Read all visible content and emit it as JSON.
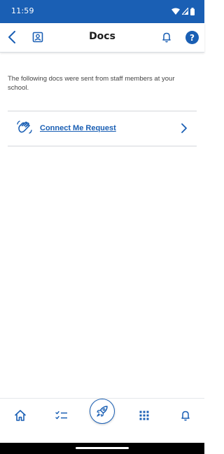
{
  "status_bar": {
    "time": "11:59",
    "background": "#1a5fb4"
  },
  "header": {
    "title": "Docs",
    "icons": [
      "back-icon",
      "profile-card-icon",
      "bell-icon",
      "help-icon"
    ]
  },
  "content": {
    "intro_text": "The following docs were sent from staff members at your school.",
    "docs": [
      {
        "label": "Connect Me Request",
        "icon": "waving-hand-icon"
      }
    ]
  },
  "bottom_nav": {
    "items": [
      "home-icon",
      "checklist-icon",
      "rocket-icon",
      "apps-grid-icon",
      "bell-icon"
    ]
  },
  "colors": {
    "accent": "#1a5fb4",
    "divider": "#d4d7db"
  }
}
